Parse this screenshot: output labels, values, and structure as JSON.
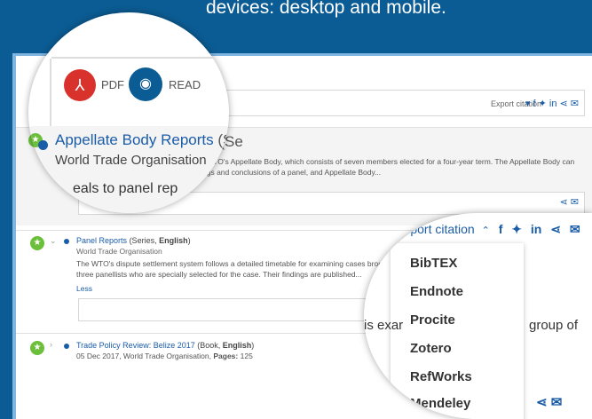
{
  "caption": "devices: desktop and mobile.",
  "top_magnifier": {
    "pdf_label": "PDF",
    "read_label": "READ"
  },
  "export_citation_small": "Export citation",
  "item1": {
    "title": "Appellate Body Reports",
    "title_suffix": "(Se",
    "publisher": "World Trade Organisation",
    "description_part1": "the WTO's Appellate Body, which consists of seven members elected for a four-year term. The Appellate Body can",
    "description_part2": "ngs and conclusions of a panel, and Appellate Body...",
    "partial_text": "eals to panel rep"
  },
  "item2": {
    "title": "Panel Reports",
    "meta_open": "(Series, ",
    "meta_lang": "English",
    "meta_close": ")",
    "publisher": "World Trade Organisation",
    "description_line1": "The WTO's dispute settlement system follows a detailed timetable for examining cases brought to",
    "description_line2": "three panellists who are specially selected for the case. Their findings are published...",
    "less_label": "Less",
    "overlay_text_left": "is exar",
    "overlay_text_right": "group of"
  },
  "item3": {
    "title": "Trade Policy Review: Belize 2017",
    "meta_open": "(Book, ",
    "meta_lang": "English",
    "meta_close": ")",
    "date_line_prefix": "05 Dec 2017, World Trade Organisation, ",
    "pages_label": "Pages:",
    "pages_value": "125"
  },
  "citation_dropdown": {
    "label": "Export citation",
    "options": [
      "BibTEX",
      "Endnote",
      "Procite",
      "Zotero",
      "RefWorks",
      "Mendeley"
    ]
  },
  "colors": {
    "background": "#0b5c94",
    "accent": "#1a5ca8",
    "pdf": "#d9312b",
    "star": "#6cbf3b"
  },
  "icons": [
    "facebook-icon",
    "twitter-icon",
    "linkedin-icon",
    "share-icon",
    "mail-icon",
    "star-icon",
    "chevron-up-icon",
    "chevron-down-icon",
    "chevron-right-icon",
    "pdf-icon",
    "eye-icon"
  ]
}
